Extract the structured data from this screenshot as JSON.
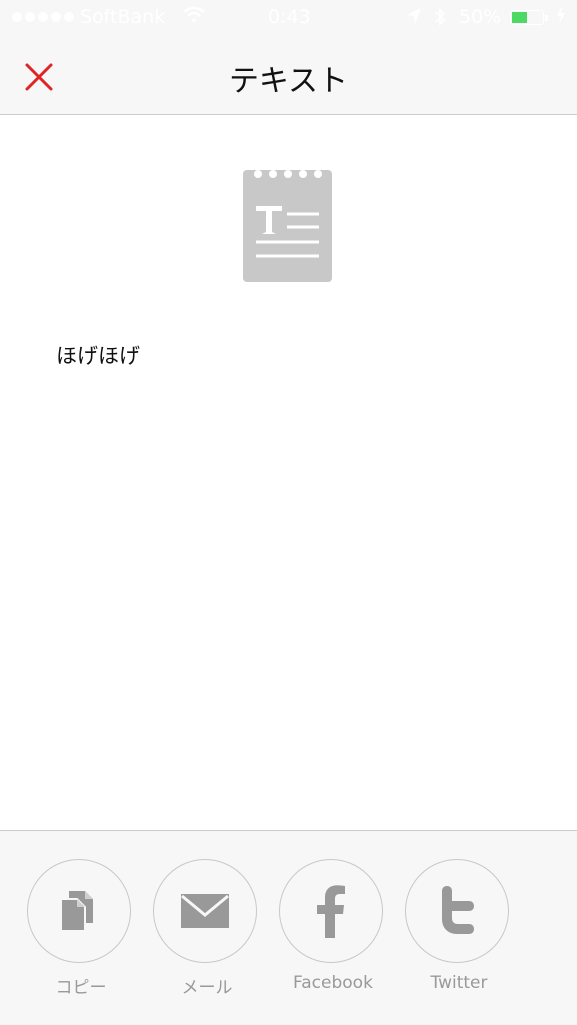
{
  "status_bar": {
    "carrier": "SoftBank",
    "time": "0:43",
    "battery_percent": "50%",
    "battery_level": 0.5,
    "battery_color": "#4cd964"
  },
  "nav": {
    "title": "テキスト",
    "close_icon": "close-x-icon",
    "accent_color": "#e02424"
  },
  "content": {
    "icon": "text-note-icon",
    "text": "ほげほげ"
  },
  "share": {
    "items": [
      {
        "label": "コピー",
        "icon": "copy-icon"
      },
      {
        "label": "メール",
        "icon": "mail-icon"
      },
      {
        "label": "Facebook",
        "icon": "facebook-icon"
      },
      {
        "label": "Twitter",
        "icon": "twitter-icon"
      }
    ]
  }
}
